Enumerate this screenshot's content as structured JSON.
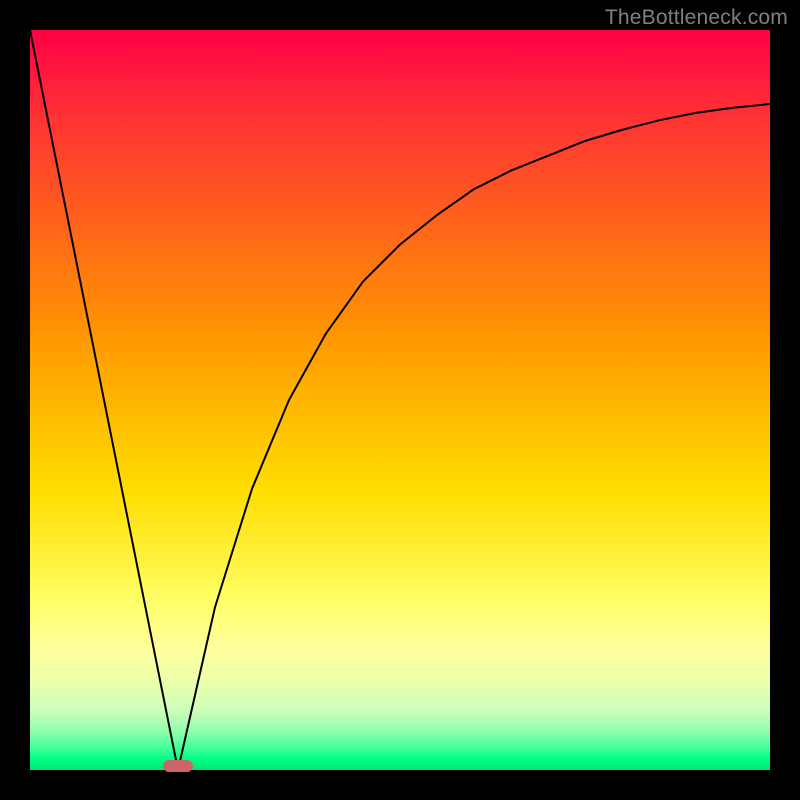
{
  "watermark": "TheBottleneck.com",
  "chart_data": {
    "type": "line",
    "title": "",
    "xlabel": "",
    "ylabel": "",
    "xlim": [
      0,
      100
    ],
    "ylim": [
      0,
      100
    ],
    "grid": false,
    "series": [
      {
        "name": "left-slope",
        "x": [
          0,
          20
        ],
        "values": [
          100,
          0
        ]
      },
      {
        "name": "right-curve",
        "x": [
          20,
          25,
          30,
          35,
          40,
          45,
          50,
          55,
          60,
          65,
          70,
          75,
          80,
          85,
          90,
          95,
          100
        ],
        "values": [
          0,
          22,
          38,
          50,
          59,
          66,
          71,
          75,
          78.5,
          81,
          83,
          85,
          86.5,
          87.8,
          88.8,
          89.5,
          90
        ]
      }
    ],
    "markers": [
      {
        "name": "optimal-point",
        "x": 20,
        "y": 0.5,
        "color": "#cc6666"
      }
    ],
    "background_gradient": {
      "direction": "vertical",
      "stops": [
        {
          "pos": 0,
          "color": "#ff0044"
        },
        {
          "pos": 50,
          "color": "#ffcc00"
        },
        {
          "pos": 80,
          "color": "#ffff66"
        },
        {
          "pos": 100,
          "color": "#00e673"
        }
      ]
    }
  }
}
